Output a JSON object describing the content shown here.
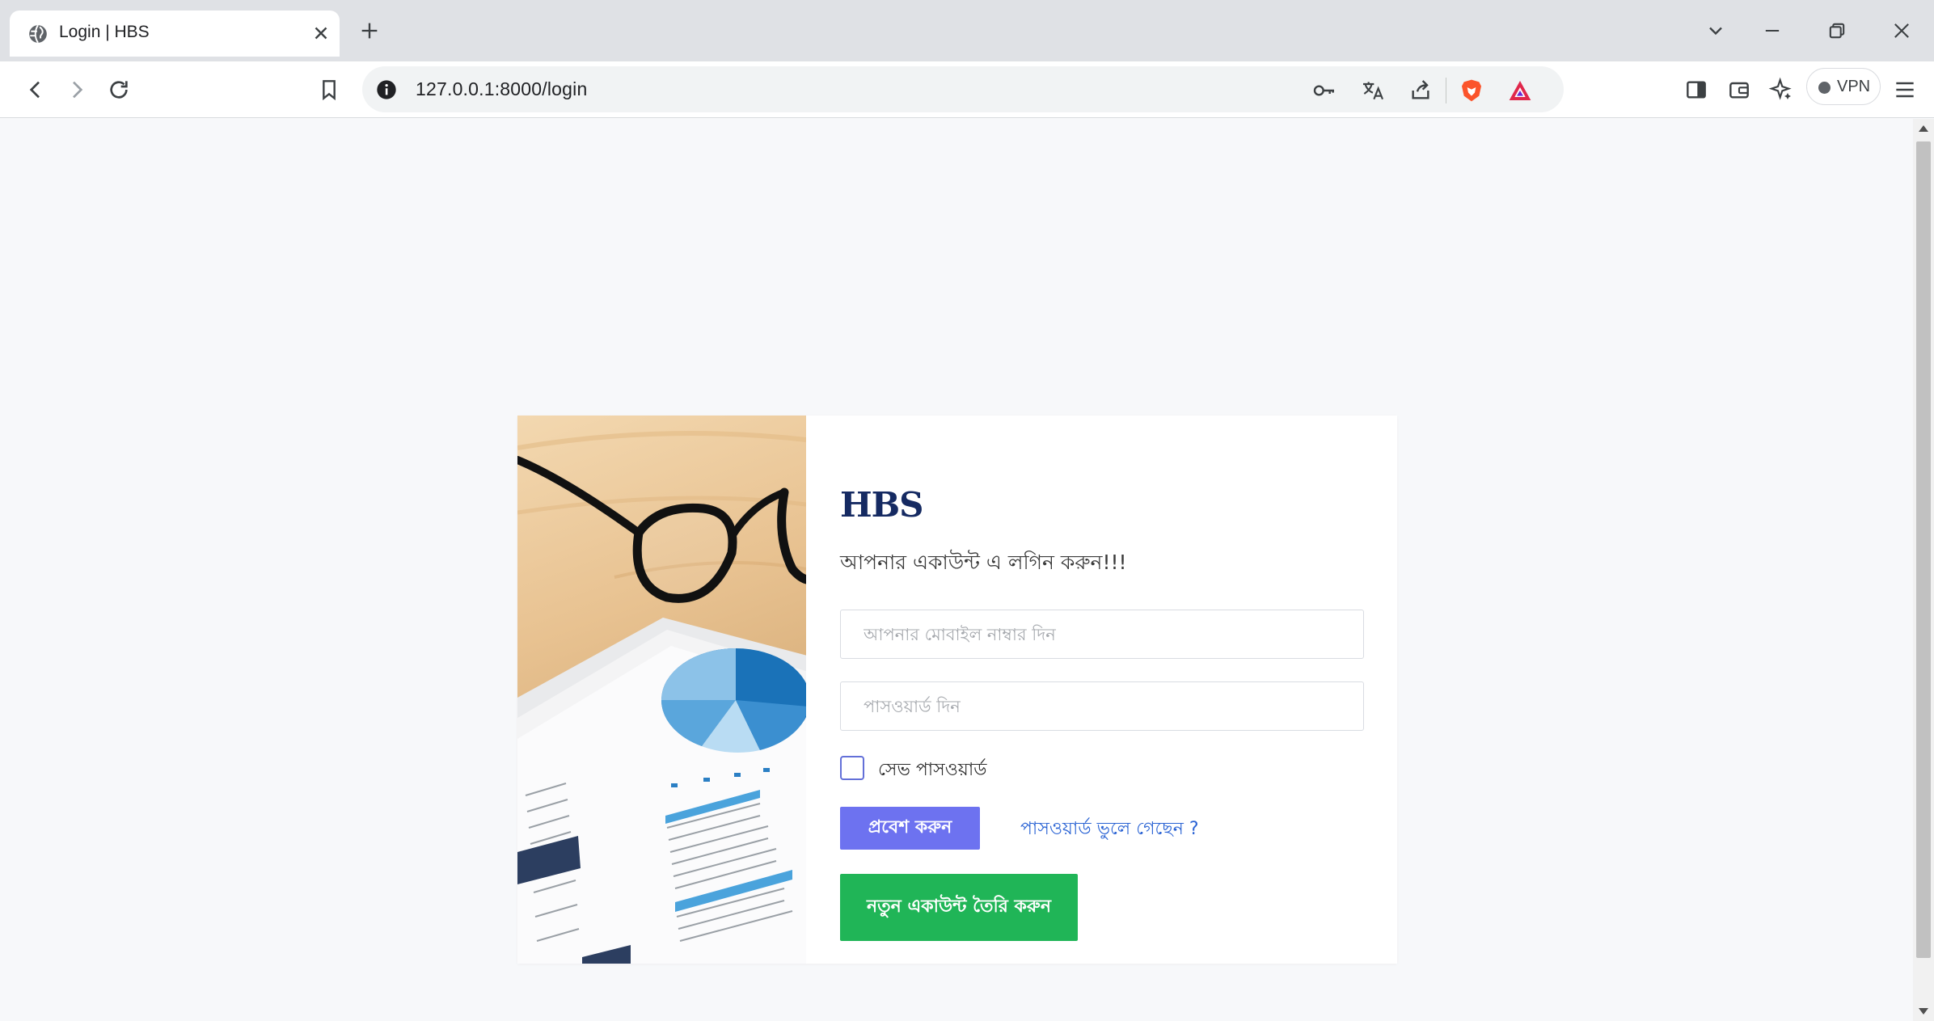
{
  "browser": {
    "tab": {
      "title": "Login | HBS",
      "favicon": "globe-icon"
    },
    "new_tab_icon": "plus-icon",
    "window_controls": [
      "chevron-down-icon",
      "minimize-icon",
      "restore-icon",
      "close-icon"
    ],
    "address_bar": {
      "url": "127.0.0.1:8000/login"
    },
    "toolbar_icons": [
      "back-icon",
      "forward-icon",
      "reload-icon",
      "bookmark-icon",
      "password-key-icon",
      "translate-icon",
      "share-icon",
      "brave-shields-icon",
      "brave-rewards-icon",
      "sidebar-icon",
      "wallet-icon",
      "leo-ai-icon",
      "menu-icon"
    ],
    "vpn_label": "VPN"
  },
  "login": {
    "brand": "HBS",
    "subtitle": "আপনার একাউন্ট এ লগিন করুন!!!",
    "mobile_placeholder": "আপনার মোবাইল নাম্বার দিন",
    "password_placeholder": "পাসওয়ার্ড দিন",
    "remember_label": "সেভ পাসওয়ার্ড",
    "remember_checked": false,
    "login_button": "প্রবেশ করুন",
    "forgot_link": "পাসওয়ার্ড ভুলে গেছেন ?",
    "register_button": "নতুন একাউন্ট তৈরি করুন"
  },
  "colors": {
    "brand": "#152a62",
    "login_button": "#6d72f0",
    "register_button": "#20b557",
    "link": "#2a63d4",
    "checkbox_border": "#6370d8"
  }
}
